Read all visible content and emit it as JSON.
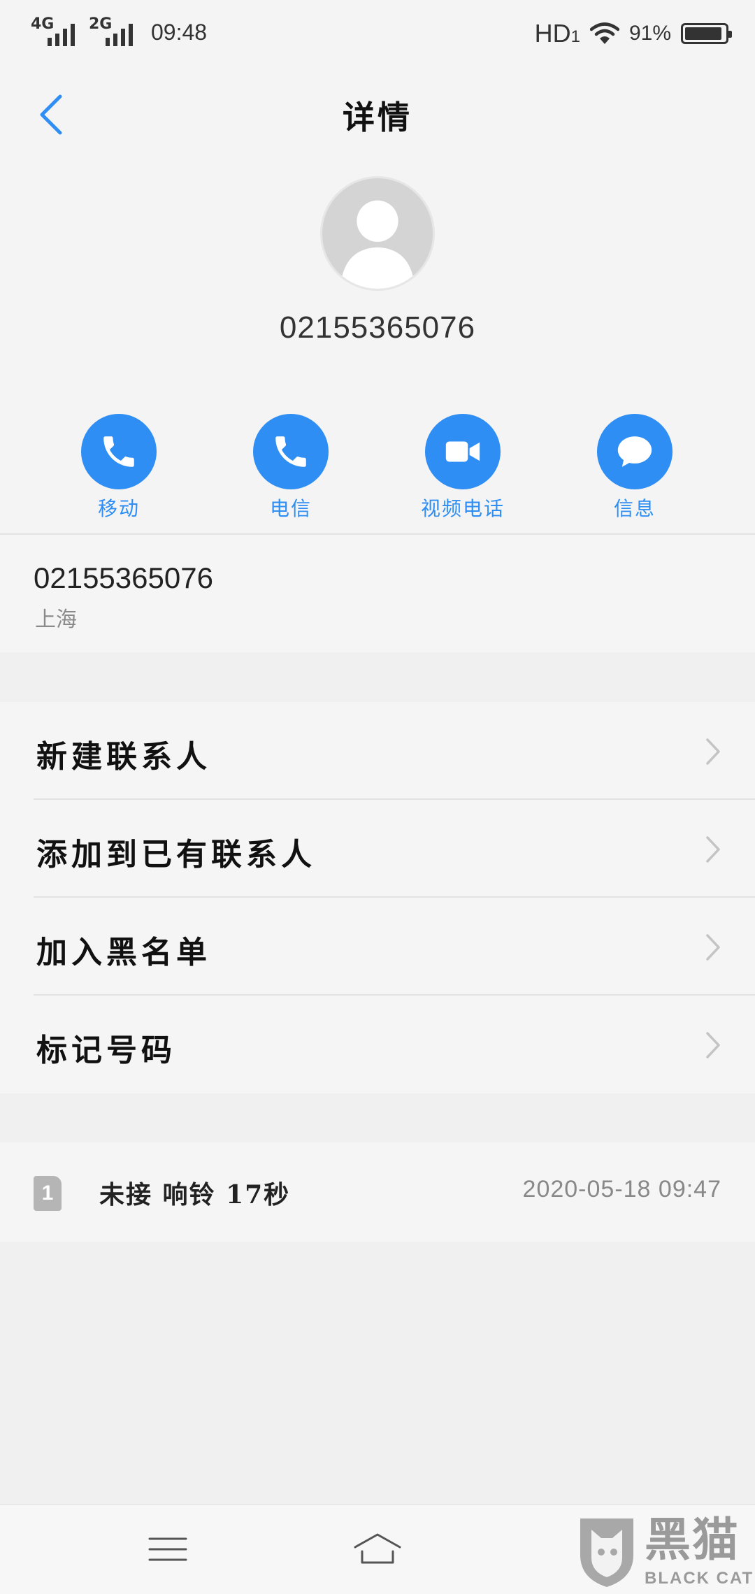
{
  "status_bar": {
    "net1": "4G",
    "net2": "2G",
    "time": "09:48",
    "hd": "HD",
    "hd_sub": "1",
    "battery": "91%"
  },
  "header": {
    "title": "详情"
  },
  "contact": {
    "name": "02155365076"
  },
  "actions": [
    {
      "label": "移动",
      "icon": "phone-icon"
    },
    {
      "label": "电信",
      "icon": "phone-icon"
    },
    {
      "label": "视频电话",
      "icon": "video-camera-icon"
    },
    {
      "label": "信息",
      "icon": "message-bubble-icon"
    }
  ],
  "number": {
    "value": "02155365076",
    "location": "上海"
  },
  "menu": [
    {
      "label": "新建联系人"
    },
    {
      "label": "添加到已有联系人"
    },
    {
      "label": "加入黑名单"
    },
    {
      "label": "标记号码"
    }
  ],
  "call_log": {
    "sim": "1",
    "status": "未接 响铃 17秒",
    "datetime": "2020-05-18 09:47"
  },
  "watermark": {
    "text": "黑猫",
    "sub": "BLACK CAT"
  },
  "colors": {
    "accent": "#2e8ef4",
    "background": "#f0f0f0",
    "card": "#f5f5f5"
  }
}
